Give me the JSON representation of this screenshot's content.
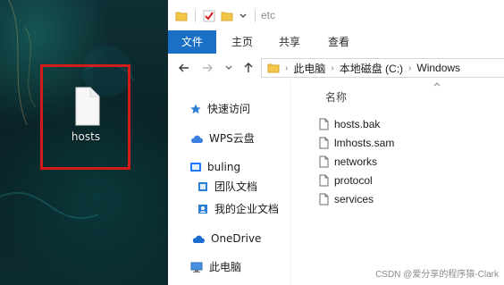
{
  "desktop": {
    "file_label": "hosts"
  },
  "explorer": {
    "title": "etc",
    "ribbon_tabs": [
      "文件",
      "主页",
      "共享",
      "查看"
    ],
    "breadcrumb": [
      "此电脑",
      "本地磁盘 (C:)",
      "Windows"
    ],
    "nav_items": [
      {
        "label": "快速访问"
      },
      {
        "label": "WPS云盘"
      },
      {
        "label": "buling"
      },
      {
        "label": "团队文档"
      },
      {
        "label": "我的企业文档"
      },
      {
        "label": "OneDrive"
      },
      {
        "label": "此电脑"
      }
    ],
    "column_header": "名称",
    "files": [
      "hosts.bak",
      "lmhosts.sam",
      "networks",
      "protocol",
      "services"
    ]
  },
  "watermark": "CSDN @爱分享的程序猿-Clark",
  "colors": {
    "ribbon_primary": "#1a6fc7",
    "highlight_red": "#d21b1b",
    "folder_yellow": "#f4c64a"
  }
}
